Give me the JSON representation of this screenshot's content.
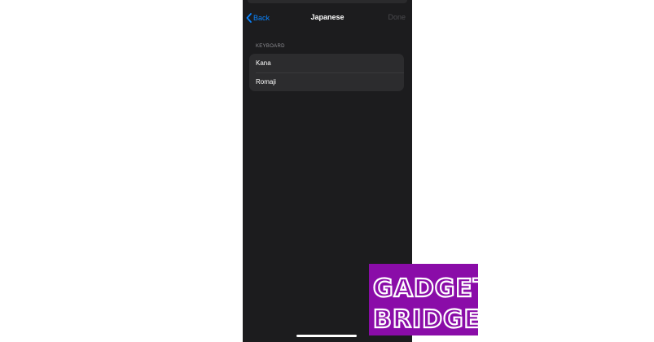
{
  "nav": {
    "back_label": "Back",
    "title": "Japanese",
    "done_label": "Done"
  },
  "keyboard_section": {
    "header": "KEYBOARD",
    "items": [
      {
        "label": "Kana"
      },
      {
        "label": "Romaji"
      }
    ]
  },
  "watermark": {
    "line1": "GADGET",
    "line2": "BRIDGE",
    "background_color": "#8a0ca8"
  },
  "colors": {
    "screen_background": "#1c1c1e",
    "group_background": "#2c2c2e",
    "accent": "#0a84ff",
    "disabled_text": "#4a4a4e",
    "section_header_text": "#8e8e93"
  }
}
